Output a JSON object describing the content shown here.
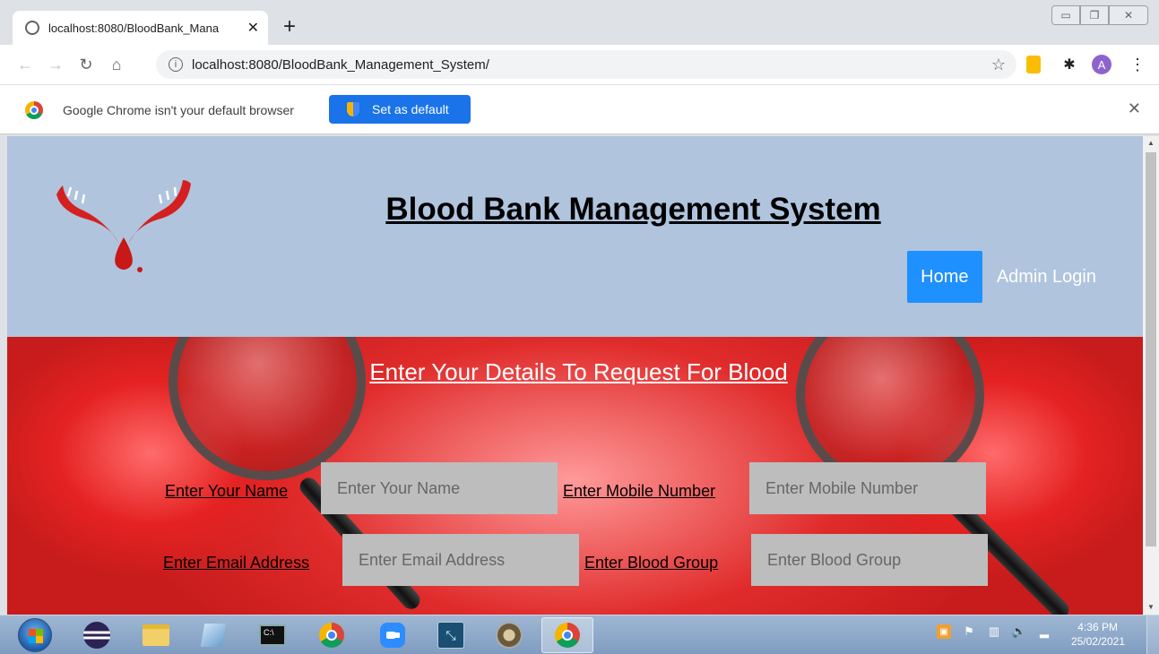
{
  "browser": {
    "tab_title": "localhost:8080/BloodBank_Mana",
    "tab_close": "✕",
    "new_tab": "+",
    "url": "localhost:8080/BloodBank_Management_System/",
    "avatar_letter": "A",
    "infobar_message": "Google Chrome isn't your default browser",
    "set_default_label": "Set as default",
    "infobar_close": "✕"
  },
  "header": {
    "title": "Blood Bank Management System",
    "nav": {
      "home": "Home",
      "admin_login": "Admin Login"
    },
    "background_color": "#b0c4de",
    "active_nav_color": "#1e90ff"
  },
  "form": {
    "heading": "Enter Your Details To Request For Blood",
    "fields": {
      "name": {
        "label": "Enter Your Name",
        "placeholder": "Enter Your Name"
      },
      "mobile": {
        "label": "Enter Mobile Number",
        "placeholder": "Enter Mobile Number"
      },
      "email": {
        "label": "Enter Email Address",
        "placeholder": "Enter Email Address"
      },
      "blood_group": {
        "label": "Enter Blood Group",
        "placeholder": "Enter Blood Group"
      }
    }
  },
  "taskbar": {
    "time": "4:36 PM",
    "date": "25/02/2021",
    "items": [
      "windows-start-icon",
      "eclipse-icon",
      "folder-icon",
      "notepad-icon",
      "cmd-icon",
      "chrome-icon",
      "zoom-icon",
      "mysql-workbench-icon",
      "gear-app-icon",
      "chrome-active-icon"
    ]
  }
}
